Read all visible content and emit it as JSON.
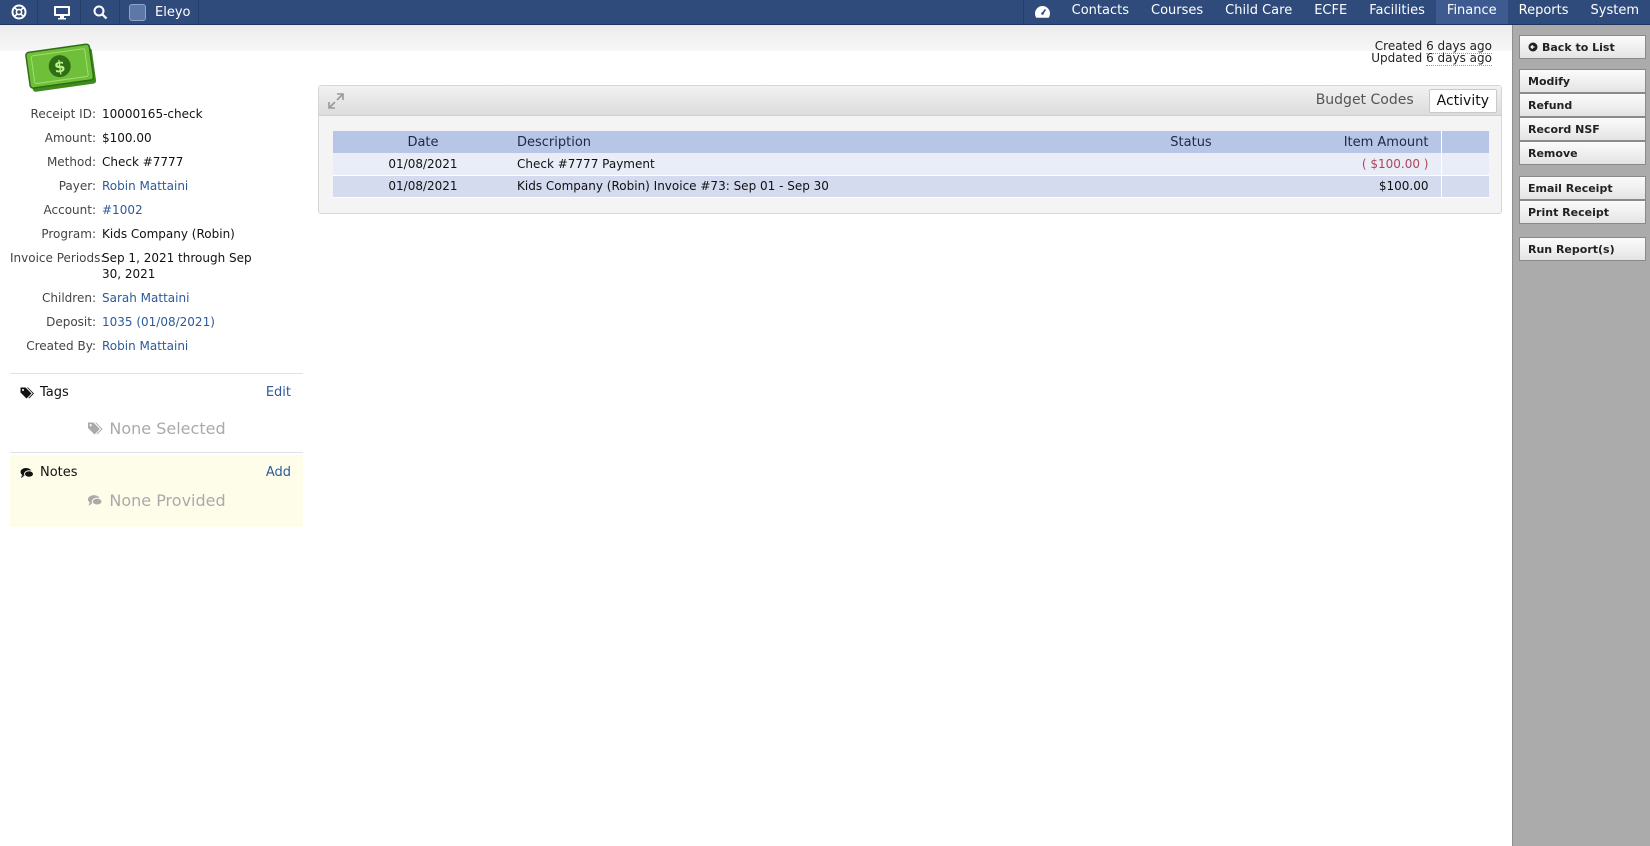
{
  "topbar": {
    "brand": "Eleyo",
    "nav": [
      "Contacts",
      "Courses",
      "Child Care",
      "ECFE",
      "Facilities",
      "Finance",
      "Reports",
      "System"
    ],
    "active": "Finance"
  },
  "meta": {
    "created_label": "Created",
    "created_value": "6 days ago",
    "updated_label": "Updated",
    "updated_value": "6 days ago"
  },
  "details": [
    {
      "label": "Receipt ID:",
      "value": "10000165-check",
      "link": false
    },
    {
      "label": "Amount:",
      "value": "$100.00",
      "link": false
    },
    {
      "label": "Method:",
      "value": "Check #7777",
      "link": false
    },
    {
      "label": "Payer:",
      "value": "Robin Mattaini",
      "link": true
    },
    {
      "label": "Account:",
      "value": "#1002",
      "link": true
    },
    {
      "label": "Program:",
      "value": "Kids Company (Robin)",
      "link": false
    },
    {
      "label": "Invoice Periods:",
      "value": "Sep 1, 2021 through Sep 30, 2021",
      "link": false
    },
    {
      "label": "Children:",
      "value": "Sarah Mattaini",
      "link": true
    },
    {
      "label": "Deposit:",
      "value": "1035 (01/08/2021)",
      "link": true
    },
    {
      "label": "Created By:",
      "value": "Robin Mattaini",
      "link": true
    }
  ],
  "tags": {
    "title": "Tags",
    "action": "Edit",
    "empty": "None Selected"
  },
  "notes": {
    "title": "Notes",
    "action": "Add",
    "empty": "None Provided"
  },
  "panel": {
    "tabs": [
      "Budget Codes",
      "Activity"
    ],
    "active_tab": "Activity",
    "columns": [
      "Date",
      "Description",
      "Status",
      "Item Amount"
    ],
    "rows": [
      {
        "date": "01/08/2021",
        "description": "Check #7777 Payment",
        "status": "",
        "amount": "( $100.00 )"
      },
      {
        "date": "01/08/2021",
        "description": "Kids Company (Robin) Invoice #73: Sep 01 - Sep 30",
        "status": "",
        "amount": "$100.00"
      }
    ]
  },
  "sidebar": {
    "back": "Back to List",
    "modify": "Modify",
    "refund": "Refund",
    "record_nsf": "Record NSF",
    "remove": "Remove",
    "email_receipt": "Email Receipt",
    "print_receipt": "Print Receipt",
    "run_reports": "Run Report(s)"
  }
}
